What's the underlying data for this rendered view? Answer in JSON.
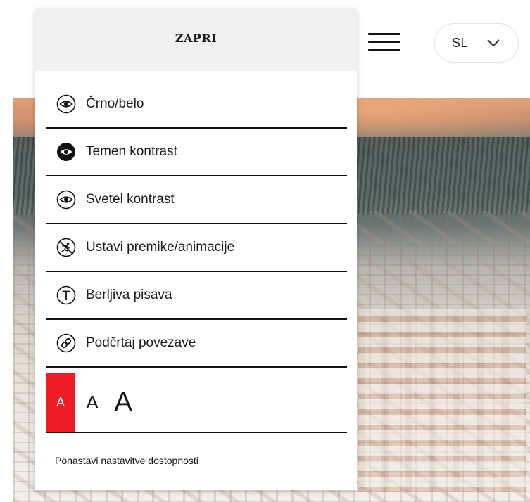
{
  "header": {
    "language": "SL"
  },
  "accessibility_panel": {
    "close_label": "ZAPRI",
    "options": [
      {
        "label": "Črno/belo",
        "icon": "eye-icon"
      },
      {
        "label": "Temen kontrast",
        "icon": "eye-filled-icon"
      },
      {
        "label": "Svetel kontrast",
        "icon": "eye-icon"
      },
      {
        "label": "Ustavi premike/animacije",
        "icon": "stop-motion-icon"
      },
      {
        "label": "Berljiva pisava",
        "icon": "text-font-icon"
      },
      {
        "label": "Podčrtaj povezave",
        "icon": "link-icon"
      }
    ],
    "font_sizes": {
      "small": "A",
      "medium": "A",
      "large": "A",
      "active": "small",
      "active_color": "#ee1c24"
    },
    "reset_label": "Ponastavi nastavitve dostopnosti"
  }
}
